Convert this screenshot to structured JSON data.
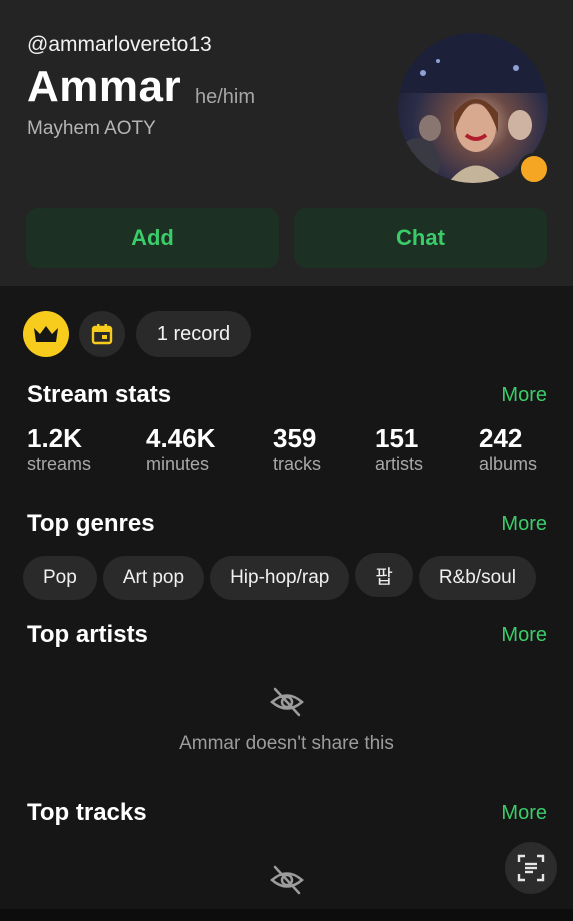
{
  "profile": {
    "username": "@ammarlovereto13",
    "display_name": "Ammar",
    "pronouns": "he/him",
    "bio": "Mayhem AOTY",
    "status_color": "#f5a623"
  },
  "actions": {
    "add_label": "Add",
    "chat_label": "Chat"
  },
  "badges": {
    "crown_icon": "crown-icon",
    "calendar_icon": "calendar-icon",
    "record_label": "1 record"
  },
  "stream_stats": {
    "title": "Stream stats",
    "more_label": "More",
    "items": [
      {
        "value": "1.2K",
        "label": "streams"
      },
      {
        "value": "4.46K",
        "label": "minutes"
      },
      {
        "value": "359",
        "label": "tracks"
      },
      {
        "value": "151",
        "label": "artists"
      },
      {
        "value": "242",
        "label": "albums"
      }
    ]
  },
  "top_genres": {
    "title": "Top genres",
    "more_label": "More",
    "items": [
      "Pop",
      "Art pop",
      "Hip-hop/rap",
      "팝",
      "R&b/soul"
    ]
  },
  "top_artists": {
    "title": "Top artists",
    "more_label": "More",
    "hidden_icon": "eye-off-icon",
    "hidden_text": "Ammar doesn't share this"
  },
  "top_tracks": {
    "title": "Top tracks",
    "more_label": "More",
    "hidden_icon": "eye-off-icon"
  },
  "colors": {
    "accent": "#3bcc6a",
    "crown_badge": "#f7cc1d",
    "button_bg": "#1d3024"
  }
}
